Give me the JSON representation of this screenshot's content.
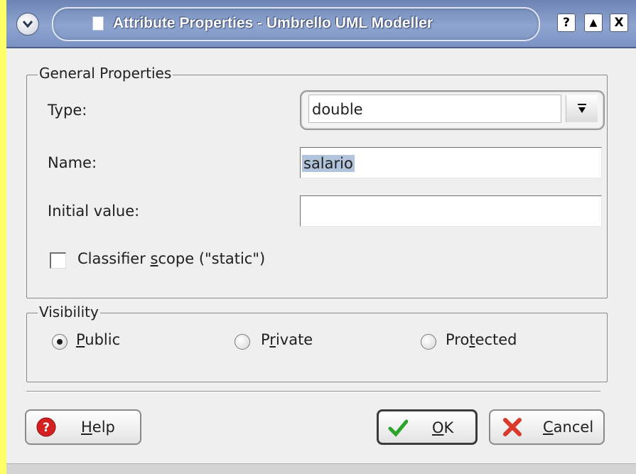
{
  "window": {
    "title": "Attribute Properties - Umbrello UML Modeller"
  },
  "titlebar_buttons": {
    "help": "?",
    "maximize": "▲",
    "close": "X"
  },
  "general_properties": {
    "title": "General Properties",
    "type_label": "Type:",
    "type_value": "double",
    "name_label": "Name:",
    "name_value": "salario",
    "initial_value_label": "Initial value:",
    "initial_value": "",
    "classifier_scope": {
      "label_before": "Classifier ",
      "label_mnemonic": "s",
      "label_after": "cope (\"static\")",
      "checked": false
    }
  },
  "visibility": {
    "title": "Visibility",
    "options": [
      {
        "before": "",
        "mnemonic": "P",
        "after": "ublic",
        "selected": true
      },
      {
        "before": "P",
        "mnemonic": "r",
        "after": "ivate",
        "selected": false
      },
      {
        "before": "Pro",
        "mnemonic": "t",
        "after": "ected",
        "selected": false
      }
    ]
  },
  "buttons": {
    "help": {
      "mnemonic": "H",
      "after": "elp"
    },
    "ok": {
      "mnemonic": "O",
      "after": "K"
    },
    "cancel": {
      "mnemonic": "C",
      "after": "ancel"
    }
  },
  "colors": {
    "background": "#ffff66",
    "dialog": "#efefef",
    "titlebar": "#7b91c2",
    "selection": "#b2c3dc",
    "ok_check": "#2aa52a",
    "cancel_x": "#d93a2b",
    "help_red": "#d42020"
  },
  "icons": {
    "window_menu": "chevron-down-icon",
    "title_document": "document-icon",
    "combo_dropdown": "arrow-down-icon",
    "help_button": "help-circle-icon",
    "ok_button": "check-icon",
    "cancel_button": "cancel-x-icon"
  }
}
